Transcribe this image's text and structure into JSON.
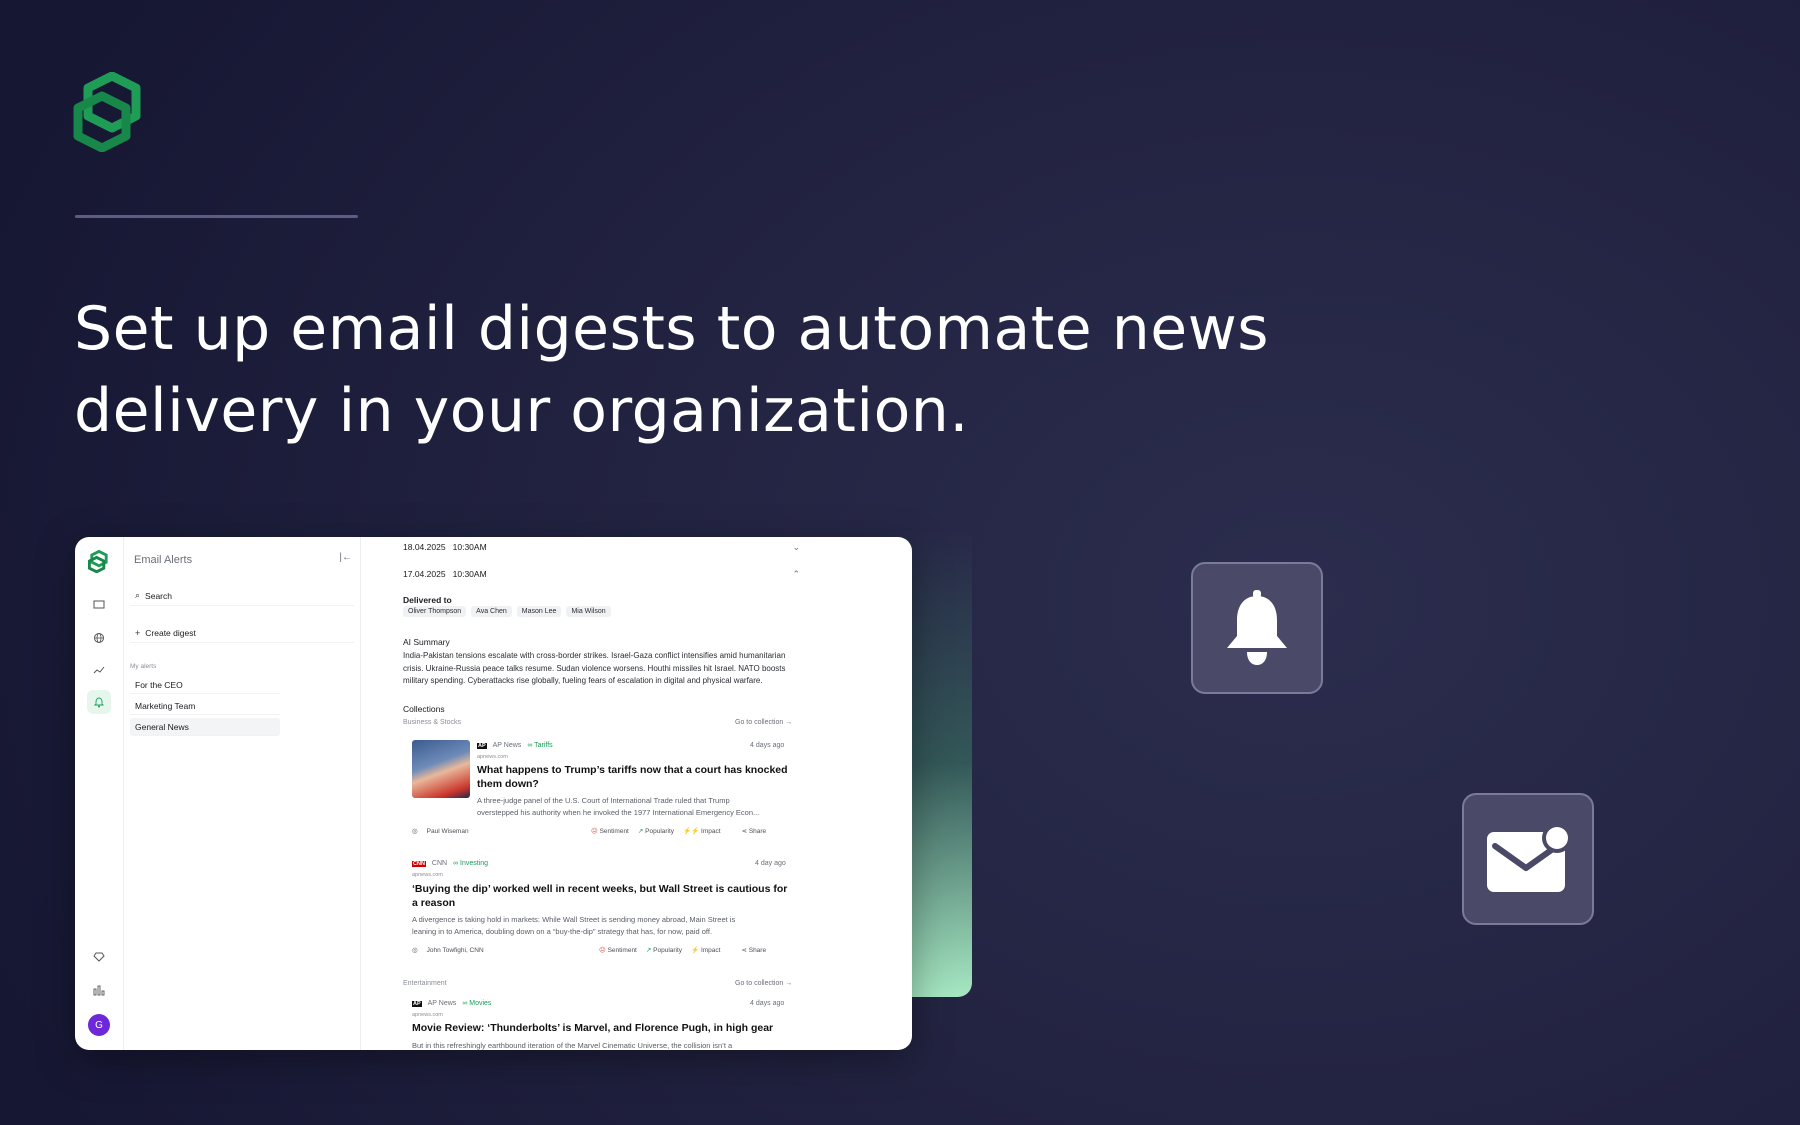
{
  "hero": {
    "headline_line1": "Set up email digests to automate news",
    "headline_line2": "delivery in your organization."
  },
  "colors": {
    "accent": "#1aa05a",
    "background": "#1c1d3a",
    "tile": "#4a4a68",
    "avatar": "#6d28d9"
  },
  "app": {
    "rail": {
      "avatar_letter": "G",
      "icons": [
        "logo-icon",
        "monitor-icon",
        "globe-icon",
        "trend-icon",
        "bell-icon",
        "diamond-icon",
        "chart-icon"
      ]
    },
    "panel": {
      "title": "Email Alerts",
      "search_label": "Search",
      "create_label": "Create digest",
      "section_label": "My alerts",
      "items": [
        {
          "label": "For the CEO"
        },
        {
          "label": "Marketing Team"
        },
        {
          "label": "General News"
        }
      ]
    },
    "digests": [
      {
        "date": "18.04.2025",
        "time": "10:30AM"
      },
      {
        "date": "17.04.2025",
        "time": "10:30AM"
      }
    ],
    "delivered_label": "Delivered to",
    "recipients": [
      "Oliver Thompson",
      "Ava Chen",
      "Mason Lee",
      "Mia Wilson"
    ],
    "ai_summary_label": "AI Summary",
    "ai_summary": "India-Pakistan tensions escalate with cross-border strikes. Israel-Gaza conflict intensifies amid humanitarian crisis. Ukraine-Russia peace talks resume. Sudan violence worsens. Houthi missiles hit Israel. NATO boosts military spending. Cyberattacks rise globally, fueling fears of escalation in digital and physical warfare.",
    "collections_label": "Collections",
    "go_to_collection": "Go to collection →",
    "collections": [
      {
        "name": "Business & Stocks"
      },
      {
        "name": "Entertainment"
      }
    ],
    "articles": [
      {
        "source": "AP News",
        "source_badge": "AP",
        "tag": "Tariffs",
        "domain": "apnews.com",
        "ago": "4 days ago",
        "title_line1": "What happens to Trump’s tariffs now that a court has knocked",
        "title_line2": "them down?",
        "snippet_line1": "A three-judge panel of the U.S. Court of International Trade ruled that Trump",
        "snippet_line2": "overstepped his authority when he invoked the 1977 International Emergency Econ...",
        "author": "Paul Wiseman",
        "sentiment": "Sentiment",
        "popularity": "Popularity",
        "impact": "Impact",
        "share": "Share"
      },
      {
        "source": "CNN",
        "source_badge": "CNN",
        "tag": "Investing",
        "domain": "apnews.com",
        "ago": "4 day ago",
        "title_line1": "‘Buying the dip’ worked well in recent weeks, but Wall Street is cautious for",
        "title_line2": "a reason",
        "snippet_line1": "A divergence is taking hold in markets: While Wall Street is sending money abroad, Main Street is",
        "snippet_line2": "leaning in to America, doubling down on a “buy-the-dip” strategy that has, for now, paid off.",
        "author": "John Towfighi, CNN",
        "sentiment": "Sentiment",
        "popularity": "Popularity",
        "impact": "Impact",
        "share": "Share"
      },
      {
        "source": "AP News",
        "source_badge": "AP",
        "tag": "Movies",
        "domain": "apnews.com",
        "ago": "4 days ago",
        "title_line1": "Movie Review: ‘Thunderbolts’ is Marvel, and Florence Pugh, in high gear",
        "snippet_line1": "But in this refreshingly earthbound iteration of the Marvel Cinematic Universe, the collision isn’t a"
      }
    ]
  }
}
